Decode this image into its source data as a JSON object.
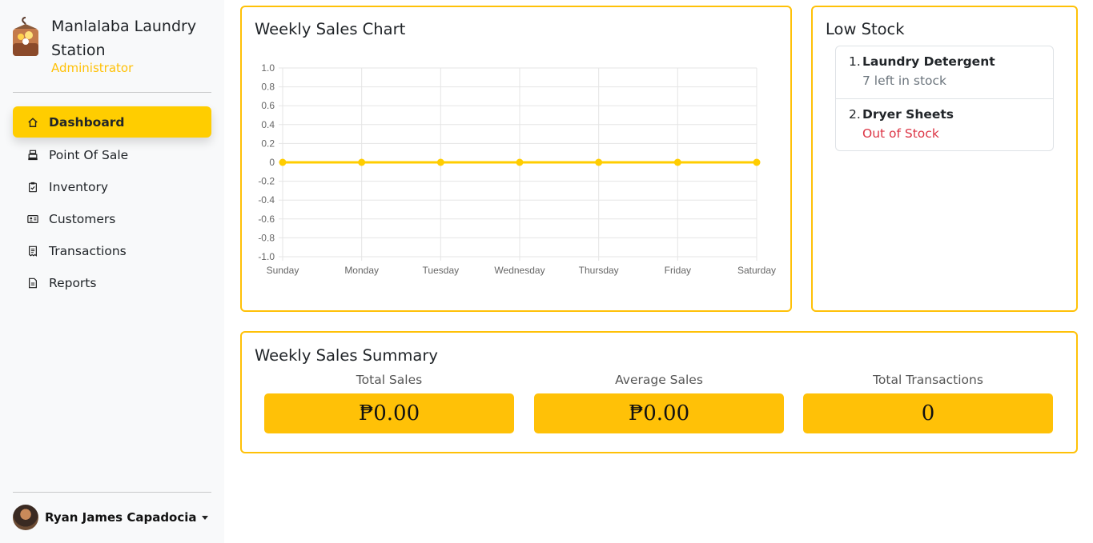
{
  "brand": {
    "name": "Manlalaba Laundry Station",
    "role": "Administrator"
  },
  "nav": [
    {
      "label": "Dashboard",
      "icon": "home-icon",
      "active": true
    },
    {
      "label": "Point Of Sale",
      "icon": "cash-register-icon",
      "active": false
    },
    {
      "label": "Inventory",
      "icon": "clipboard-check-icon",
      "active": false
    },
    {
      "label": "Customers",
      "icon": "person-card-icon",
      "active": false
    },
    {
      "label": "Transactions",
      "icon": "receipt-icon",
      "active": false
    },
    {
      "label": "Reports",
      "icon": "document-icon",
      "active": false
    }
  ],
  "user": {
    "name": "Ryan James Capadocia"
  },
  "weekly_chart": {
    "title": "Weekly Sales Chart"
  },
  "chart_data": {
    "type": "line",
    "categories": [
      "Sunday",
      "Monday",
      "Tuesday",
      "Wednesday",
      "Thursday",
      "Friday",
      "Saturday"
    ],
    "values": [
      0,
      0,
      0,
      0,
      0,
      0,
      0
    ],
    "ylim": [
      -1.0,
      1.0
    ],
    "yticks": [
      "1.0",
      "0.8",
      "0.6",
      "0.4",
      "0.2",
      "0",
      "-0.2",
      "-0.4",
      "-0.6",
      "-0.8",
      "-1.0"
    ],
    "color": "#ffcd00",
    "grid": true,
    "legend": "none"
  },
  "low_stock": {
    "title": "Low Stock",
    "items": [
      {
        "num": "1.",
        "name": "Laundry Detergent",
        "status": "7 left in stock",
        "out": false
      },
      {
        "num": "2.",
        "name": "Dryer Sheets",
        "status": "Out of Stock",
        "out": true
      }
    ]
  },
  "summary": {
    "title": "Weekly Sales Summary",
    "total_sales_label": "Total Sales",
    "total_sales_value": "₱0.00",
    "average_sales_label": "Average Sales",
    "average_sales_value": "₱0.00",
    "total_transactions_label": "Total Transactions",
    "total_transactions_value": "0"
  },
  "colors": {
    "accent": "#ffc107",
    "accent_strong": "#ffcd00",
    "danger": "#dc3545"
  }
}
